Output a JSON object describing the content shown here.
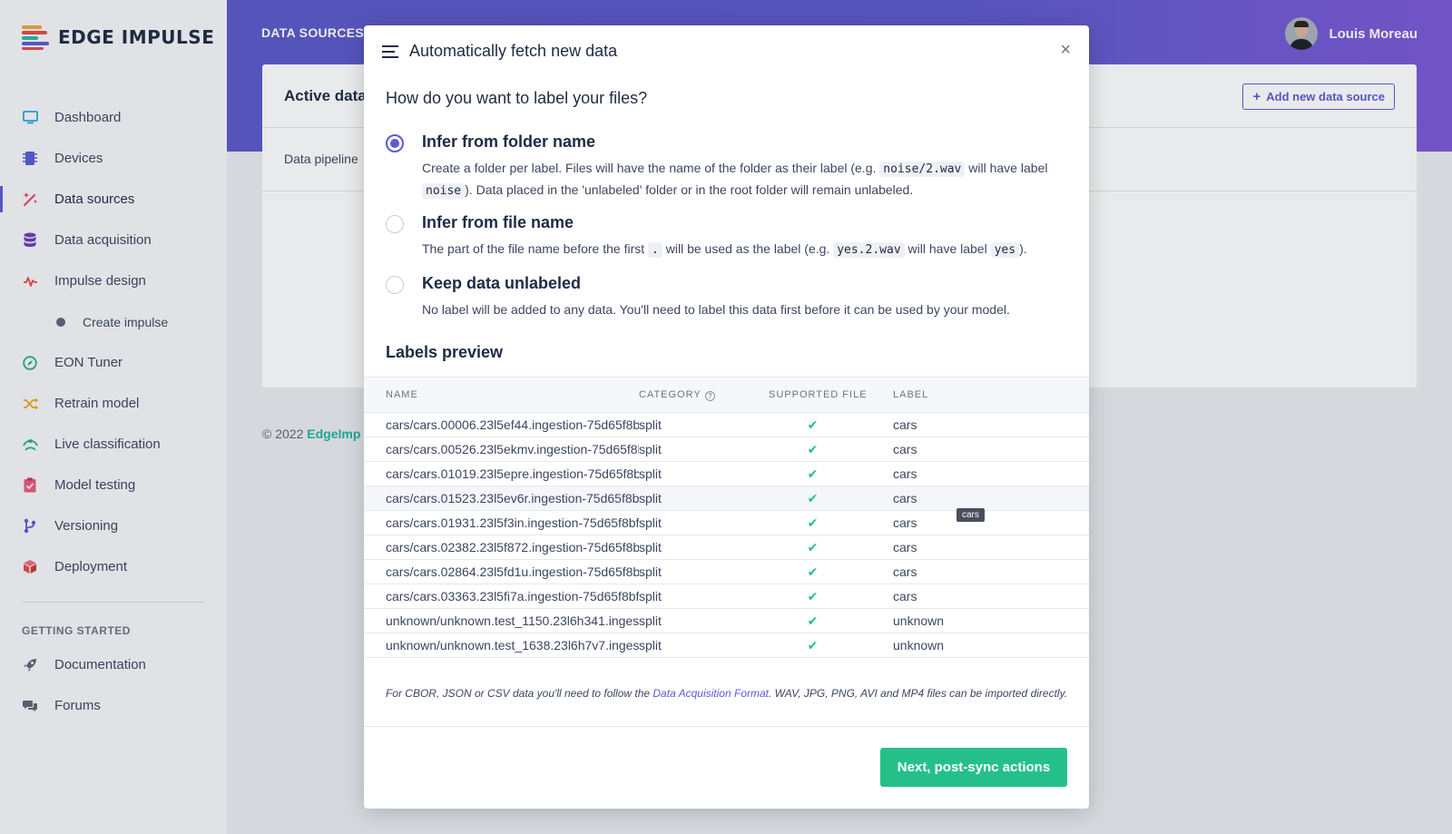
{
  "brand": {
    "name": "EDGE IMPULSE"
  },
  "sidebar": {
    "items": [
      {
        "label": "Dashboard",
        "icon": "monitor-icon"
      },
      {
        "label": "Devices",
        "icon": "chip-icon"
      },
      {
        "label": "Data sources",
        "icon": "wand-icon",
        "active": true
      },
      {
        "label": "Data acquisition",
        "icon": "database-icon"
      },
      {
        "label": "Impulse design",
        "icon": "pulse-icon"
      },
      {
        "label": "Create impulse",
        "icon": "dot-icon"
      },
      {
        "label": "EON Tuner",
        "icon": "compass-icon"
      },
      {
        "label": "Retrain model",
        "icon": "shuffle-icon"
      },
      {
        "label": "Live classification",
        "icon": "live-icon"
      },
      {
        "label": "Model testing",
        "icon": "clipboard-check-icon"
      },
      {
        "label": "Versioning",
        "icon": "branch-icon"
      },
      {
        "label": "Deployment",
        "icon": "cube-icon"
      }
    ],
    "section_heading": "GETTING STARTED",
    "help_items": [
      {
        "label": "Documentation",
        "icon": "rocket-icon"
      },
      {
        "label": "Forums",
        "icon": "chat-icon"
      }
    ]
  },
  "header": {
    "title": "DATA SOURCES",
    "user_name": "Louis Moreau"
  },
  "card": {
    "title": "Active data",
    "pipeline_label": "Data pipeline",
    "add_button": "Add new data source"
  },
  "footer": {
    "copyright": "© 2022",
    "link": "EdgeImp"
  },
  "modal": {
    "title": "Automatically fetch new data",
    "close": "×",
    "question": "How do you want to label your files?",
    "options": [
      {
        "title": "Infer from folder name",
        "checked": true,
        "desc_1": "Create a folder per label. Files will have the name of the folder as their label (e.g. ",
        "code_1": "noise/2.wav",
        "desc_2": " will have label ",
        "code_2": "noise",
        "desc_3": "). Data placed in the 'unlabeled' folder or in the root folder will remain unlabeled."
      },
      {
        "title": "Infer from file name",
        "checked": false,
        "desc_1": "The part of the file name before the first ",
        "code_1": ".",
        "desc_2": " will be used as the label (e.g. ",
        "code_2": "yes.2.wav",
        "desc_3": " will have label ",
        "code_3": "yes",
        "desc_4": ")."
      },
      {
        "title": "Keep data unlabeled",
        "checked": false,
        "desc_1": "No label will be added to any data. You'll need to label this data first before it can be used by your model."
      }
    ],
    "preview_title": "Labels preview",
    "columns": {
      "name": "NAME",
      "category": "CATEGORY",
      "supported": "SUPPORTED FILE",
      "label": "LABEL"
    },
    "rows": [
      {
        "name": "cars/cars.00006.23l5ef44.ingestion-75d65f8bf...",
        "category": "split",
        "supported": "✔",
        "label": "cars"
      },
      {
        "name": "cars/cars.00526.23l5ekmv.ingestion-75d65f8b...",
        "category": "split",
        "supported": "✔",
        "label": "cars"
      },
      {
        "name": "cars/cars.01019.23l5epre.ingestion-75d65f8bf...",
        "category": "split",
        "supported": "✔",
        "label": "cars"
      },
      {
        "name": "cars/cars.01523.23l5ev6r.ingestion-75d65f8bf...",
        "category": "split",
        "supported": "✔",
        "label": "cars"
      },
      {
        "name": "cars/cars.01931.23l5f3in.ingestion-75d65f8bf...",
        "category": "split",
        "supported": "✔",
        "label": "cars"
      },
      {
        "name": "cars/cars.02382.23l5f872.ingestion-75d65f8bf...",
        "category": "split",
        "supported": "✔",
        "label": "cars"
      },
      {
        "name": "cars/cars.02864.23l5fd1u.ingestion-75d65f8bf...",
        "category": "split",
        "supported": "✔",
        "label": "cars"
      },
      {
        "name": "cars/cars.03363.23l5fi7a.ingestion-75d65f8bf...",
        "category": "split",
        "supported": "✔",
        "label": "cars"
      },
      {
        "name": "unknown/unknown.test_1150.23l6h341.inges...",
        "category": "split",
        "supported": "✔",
        "label": "unknown"
      },
      {
        "name": "unknown/unknown.test_1638.23l6h7v7.inges...",
        "category": "split",
        "supported": "✔",
        "label": "unknown"
      }
    ],
    "tooltip": "cars",
    "note_1": "For CBOR, JSON or CSV data you'll need to follow the ",
    "note_link": "Data Acquisition Format",
    "note_2": ". WAV, JPG, PNG, AVI and MP4 files can be imported directly.",
    "next_button": "Next, post-sync actions"
  },
  "colors": {
    "accent": "#5a5bd6",
    "success": "#25c08a",
    "header": "#5b58c9",
    "link": "#1bb4a0"
  }
}
